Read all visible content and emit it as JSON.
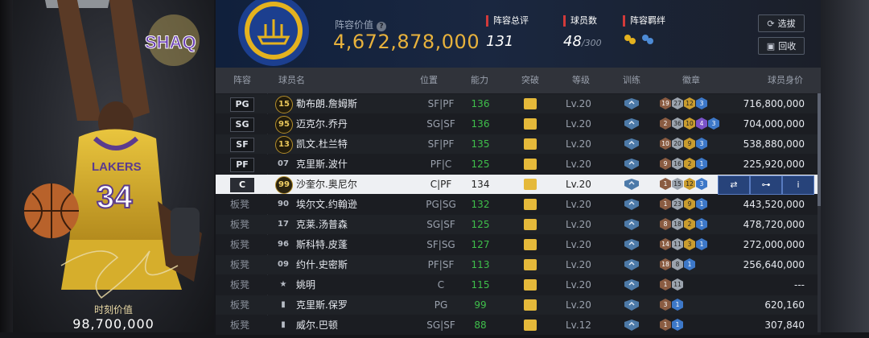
{
  "card": {
    "logo_text": "SHAQ",
    "jersey_number": "34",
    "jersey_team": "LAKERS",
    "moment_label": "时刻价值",
    "moment_value": "98,700,000"
  },
  "header": {
    "lineup_value_label": "阵容价值",
    "lineup_value": "4,672,878,000",
    "rating_label": "阵容总评",
    "rating_value": "131",
    "players_label": "球员数",
    "players_value": "48",
    "players_cap": "/300",
    "bond_label": "阵容羁绊",
    "select_button": "选拔",
    "recycle_button": "回收"
  },
  "table": {
    "headers": [
      "阵容",
      "球员名",
      "位置",
      "能力",
      "突破",
      "等级",
      "训练",
      "徽章",
      "球员身价"
    ],
    "rows": [
      {
        "slot": "PG",
        "starter": true,
        "jersey": "15",
        "jersey_style": "gold",
        "name": "勒布朗.詹姆斯",
        "position": "SF|PF",
        "ability": "136",
        "level": "Lv.20",
        "badges": [
          [
            "19",
            "b-bronze"
          ],
          [
            "27",
            "b-silver"
          ],
          [
            "12",
            "b-gold"
          ],
          [
            "3",
            "b-blue"
          ]
        ],
        "salary": "716,800,000"
      },
      {
        "slot": "SG",
        "starter": true,
        "jersey": "95",
        "jersey_style": "gold",
        "name": "迈克尔.乔丹",
        "position": "SG|SF",
        "ability": "136",
        "level": "Lv.20",
        "badges": [
          [
            "2",
            "b-bronze"
          ],
          [
            "36",
            "b-silver"
          ],
          [
            "10",
            "b-gold"
          ],
          [
            "4",
            "b-purple"
          ],
          [
            "3",
            "b-blue"
          ]
        ],
        "salary": "704,000,000"
      },
      {
        "slot": "SF",
        "starter": true,
        "jersey": "13",
        "jersey_style": "gold",
        "name": "凯文.杜兰特",
        "position": "SF|PF",
        "ability": "135",
        "level": "Lv.20",
        "badges": [
          [
            "10",
            "b-bronze"
          ],
          [
            "20",
            "b-silver"
          ],
          [
            "9",
            "b-gold"
          ],
          [
            "3",
            "b-blue"
          ]
        ],
        "salary": "538,880,000"
      },
      {
        "slot": "PF",
        "starter": true,
        "jersey": "07",
        "jersey_style": "grey",
        "name": "克里斯.波什",
        "position": "PF|C",
        "ability": "125",
        "level": "Lv.20",
        "badges": [
          [
            "9",
            "b-bronze"
          ],
          [
            "16",
            "b-silver"
          ],
          [
            "2",
            "b-gold"
          ],
          [
            "1",
            "b-blue"
          ]
        ],
        "salary": "225,920,000"
      },
      {
        "slot": "C",
        "starter": true,
        "selected": true,
        "jersey": "99",
        "jersey_style": "gold",
        "name": "沙奎尔.奥尼尔",
        "position": "C|PF",
        "ability": "134",
        "level": "Lv.20",
        "badges": [
          [
            "1",
            "b-bronze"
          ],
          [
            "15",
            "b-silver"
          ],
          [
            "12",
            "b-gold"
          ],
          [
            "3",
            "b-blue"
          ]
        ],
        "salary": ""
      },
      {
        "slot": "板凳",
        "starter": false,
        "jersey": "90",
        "jersey_style": "grey",
        "name": "埃尔文.约翰逊",
        "position": "PG|SG",
        "ability": "132",
        "level": "Lv.20",
        "badges": [
          [
            "1",
            "b-bronze"
          ],
          [
            "23",
            "b-silver"
          ],
          [
            "9",
            "b-gold"
          ],
          [
            "1",
            "b-blue"
          ]
        ],
        "salary": "443,520,000"
      },
      {
        "slot": "板凳",
        "starter": false,
        "jersey": "17",
        "jersey_style": "grey",
        "name": "克莱.汤普森",
        "position": "SG|SF",
        "ability": "125",
        "level": "Lv.20",
        "badges": [
          [
            "8",
            "b-bronze"
          ],
          [
            "18",
            "b-silver"
          ],
          [
            "2",
            "b-gold"
          ],
          [
            "1",
            "b-blue"
          ]
        ],
        "salary": "478,720,000"
      },
      {
        "slot": "板凳",
        "starter": false,
        "jersey": "96",
        "jersey_style": "grey",
        "name": "斯科特.皮蓬",
        "position": "SF|SG",
        "ability": "127",
        "level": "Lv.20",
        "badges": [
          [
            "14",
            "b-bronze"
          ],
          [
            "11",
            "b-silver"
          ],
          [
            "3",
            "b-gold"
          ],
          [
            "1",
            "b-blue"
          ]
        ],
        "salary": "272,000,000"
      },
      {
        "slot": "板凳",
        "starter": false,
        "jersey": "09",
        "jersey_style": "grey",
        "name": "约什.史密斯",
        "position": "PF|SF",
        "ability": "113",
        "level": "Lv.20",
        "badges": [
          [
            "18",
            "b-bronze"
          ],
          [
            "8",
            "b-silver"
          ],
          [
            "1",
            "b-blue"
          ]
        ],
        "salary": "256,640,000"
      },
      {
        "slot": "板凳",
        "starter": false,
        "jersey": "★",
        "jersey_style": "grey",
        "name": "姚明",
        "position": "C",
        "ability": "115",
        "level": "Lv.20",
        "badges": [
          [
            "1",
            "b-bronze"
          ],
          [
            "11",
            "b-silver"
          ]
        ],
        "salary": "---"
      },
      {
        "slot": "板凳",
        "starter": false,
        "jersey": "▮",
        "jersey_style": "grey",
        "name": "克里斯.保罗",
        "position": "PG",
        "ability": "99",
        "level": "Lv.20",
        "badges": [
          [
            "3",
            "b-bronze"
          ],
          [
            "1",
            "b-blue"
          ]
        ],
        "salary": "620,160"
      },
      {
        "slot": "板凳",
        "starter": false,
        "jersey": "▮",
        "jersey_style": "grey",
        "name": "威尔.巴顿",
        "position": "SG|SF",
        "ability": "88",
        "level": "Lv.12",
        "badges": [
          [
            "1",
            "b-bronze"
          ],
          [
            "1",
            "b-blue"
          ]
        ],
        "salary": "307,840"
      }
    ],
    "row_actions": [
      "transfer-icon",
      "train-icon",
      "info-icon"
    ]
  },
  "colors": {
    "accent_gold": "#e8b23c",
    "ability_green": "#3fbf4b",
    "tag_red": "#d23a3a",
    "selected_row": "#eef0f3"
  }
}
